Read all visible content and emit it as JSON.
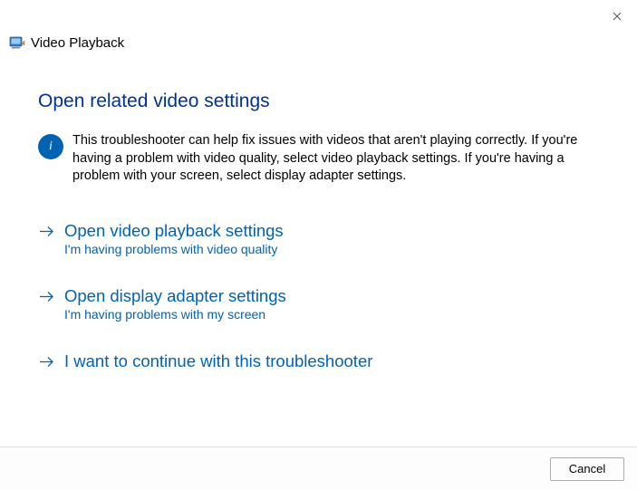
{
  "window": {
    "title": "Video Playback"
  },
  "heading": "Open related video settings",
  "info_text": "This troubleshooter can help fix issues with videos that aren't playing correctly. If you're having a problem with video quality, select video playback settings. If you're having a problem with your screen, select display adapter settings.",
  "options": [
    {
      "title": "Open video playback settings",
      "subtitle": "I'm having problems with video quality"
    },
    {
      "title": "Open display adapter settings",
      "subtitle": "I'm having problems with my screen"
    },
    {
      "title": "I want to continue with this troubleshooter",
      "subtitle": ""
    }
  ],
  "footer": {
    "cancel_label": "Cancel"
  }
}
